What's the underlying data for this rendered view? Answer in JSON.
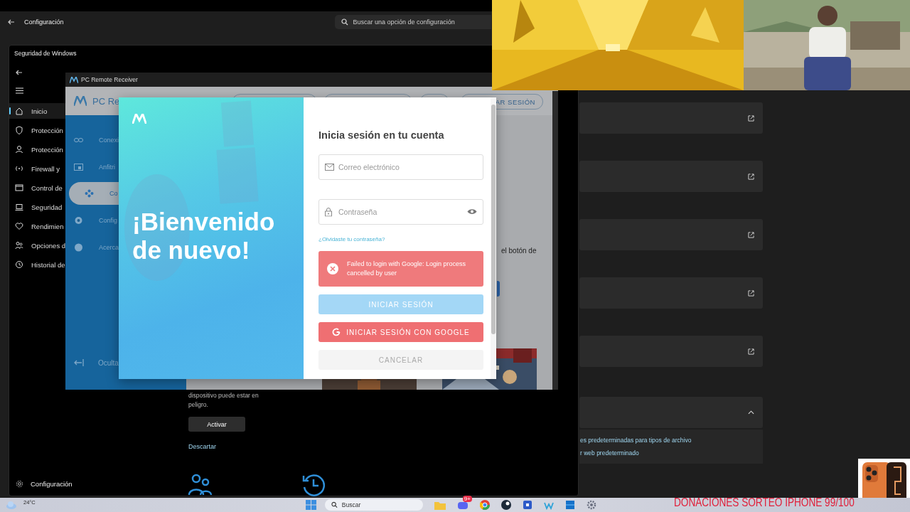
{
  "settings_window": {
    "title": "Configuración",
    "search": {
      "placeholder": "Buscar una opción de configuración"
    },
    "cards": [
      {
        "kind": "link"
      },
      {
        "kind": "link"
      },
      {
        "kind": "link"
      },
      {
        "kind": "link"
      },
      {
        "kind": "link"
      },
      {
        "kind": "expander",
        "expanded": true
      }
    ],
    "expanded_links": [
      "es predeterminadas para tipos de archivo",
      "r web predeterminado"
    ]
  },
  "security_window": {
    "title": "Seguridad de Windows",
    "nav": [
      {
        "label": "Inicio",
        "selected": true
      },
      {
        "label": "Protección",
        "selected": false
      },
      {
        "label": "Protección",
        "selected": false
      },
      {
        "label": "Firewall y",
        "selected": false
      },
      {
        "label": "Control de",
        "selected": false
      },
      {
        "label": "Seguridad",
        "selected": false
      },
      {
        "label": "Rendimien",
        "selected": false
      },
      {
        "label": "Opciones d",
        "selected": false
      },
      {
        "label": "Historial de",
        "selected": false
      }
    ],
    "footer_item": "Configuración",
    "notice": {
      "text": "dispositivo puede estar en peligro.",
      "button": "Activar",
      "link": "Descartar"
    }
  },
  "pc_remote": {
    "title": "PC Remote Receiver",
    "brand": "PC Re",
    "header_button": "AR SESIÓN",
    "nav": [
      {
        "label": "Conexi",
        "selected": false
      },
      {
        "label": "Anfitri",
        "selected": false
      },
      {
        "label": "Co",
        "selected": true
      },
      {
        "label": "Config",
        "selected": false
      },
      {
        "label": "Acerca",
        "selected": false
      }
    ],
    "hide_label": "Oculta",
    "body_text": "el botón de"
  },
  "login": {
    "welcome": "¡Bienvenido de nuevo!",
    "title": "Inicia sesión en tu cuenta",
    "email": {
      "placeholder": "Correo electrónico"
    },
    "password": {
      "placeholder": "Contraseña"
    },
    "forgot": "¿Olvidaste tu contraseña?",
    "error": "Failed to login with Google: Login process cancelled by user",
    "buttons": [
      {
        "kind": "primary",
        "label": "INICIAR SESIÓN",
        "disabled": true
      },
      {
        "kind": "google",
        "label": "INICIAR SESIÓN CON GOOGLE",
        "disabled": false
      },
      {
        "kind": "cancel",
        "label": "CANCELAR",
        "disabled": false
      }
    ]
  },
  "taskbar": {
    "weather": "24°C",
    "search": {
      "placeholder": "Buscar"
    },
    "badge": "9+"
  },
  "overlay_text": "DONACIONES SORTEO IPHONE 99/100"
}
